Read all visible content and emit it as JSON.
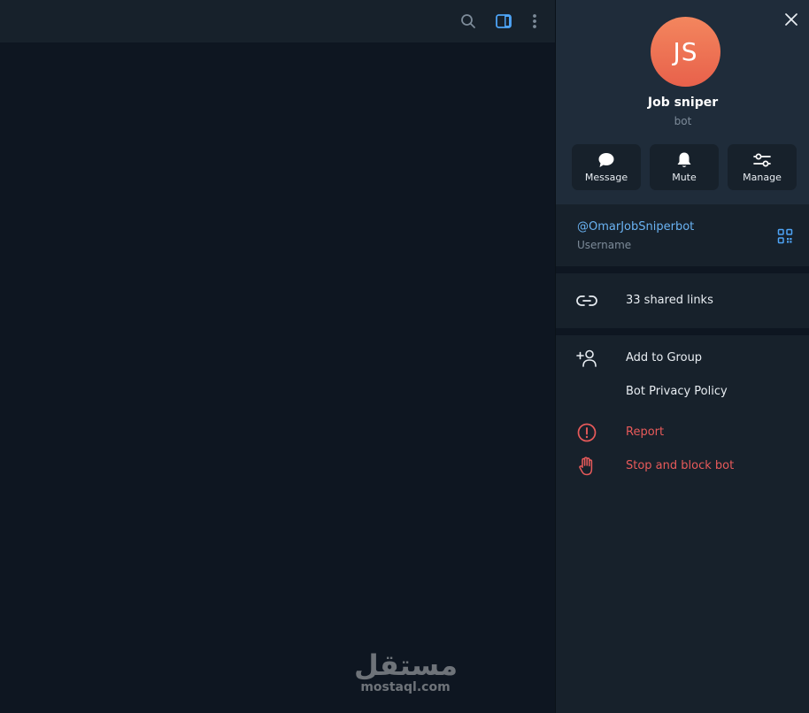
{
  "chat_header": {
    "search_icon": "search-icon",
    "panel_icon": "right-panel-toggle-icon",
    "more_icon": "more-vertical-icon"
  },
  "watermark": {
    "arabic": "مستقل",
    "latin": "mostaql.com"
  },
  "profile": {
    "initials": "JS",
    "name": "Job sniper",
    "subtitle": "bot",
    "avatar_colors": [
      "#f3865e",
      "#e8614b"
    ]
  },
  "actions": [
    {
      "label": "Message",
      "icon": "message-bubble-icon"
    },
    {
      "label": "Mute",
      "icon": "bell-icon"
    },
    {
      "label": "Manage",
      "icon": "sliders-icon"
    }
  ],
  "info": {
    "username": "@OmarJobSniperbot",
    "username_caption": "Username",
    "qr_icon": "qr-code-icon"
  },
  "links": {
    "label": "33 shared links",
    "icon": "link-icon"
  },
  "menu": [
    {
      "label": "Add to Group",
      "icon": "add-user-icon",
      "danger": false
    },
    {
      "label": "Bot Privacy Policy",
      "icon": "",
      "danger": false
    },
    {
      "label": "Report",
      "icon": "alert-circle-icon",
      "danger": true
    },
    {
      "label": "Stop and block bot",
      "icon": "hand-stop-icon",
      "danger": true
    }
  ],
  "colors": {
    "accent": "#6ab3f3",
    "danger": "#e85a5a",
    "panel_bg": "#17212b",
    "chat_bg": "#0e1621"
  }
}
